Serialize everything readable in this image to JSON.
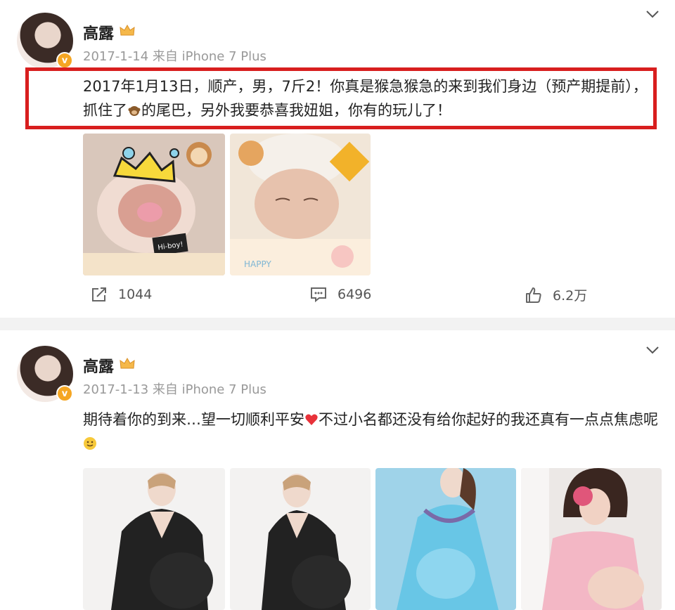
{
  "posts": [
    {
      "author": "高露",
      "meta": "2017-1-14 来自 iPhone 7 Plus",
      "text_parts": [
        "2017年1月13日，顺产，男，7斤2！你真是猴急猴急的来到我们身边（预产期提前），抓住了",
        "的尾巴，另外我要恭喜我妞姐，你有的玩儿了！"
      ],
      "images": [
        {
          "name": "baby-photo-1",
          "caption": "Hi-boy!"
        },
        {
          "name": "baby-photo-2",
          "caption": "HAPPY"
        }
      ],
      "actions": {
        "repost_count": "1044",
        "comment_count": "6496",
        "like_count": "6.2万"
      }
    },
    {
      "author": "高露",
      "meta": "2017-1-13 来自 iPhone 7 Plus",
      "text_parts": [
        "期待着你的到来…望一切顺利平安",
        "不过小名都还没有给你起好的我还真有一点点焦虑呢"
      ],
      "images": [
        {
          "name": "maternity-photo-1"
        },
        {
          "name": "maternity-photo-2"
        },
        {
          "name": "maternity-photo-3"
        },
        {
          "name": "maternity-photo-4"
        }
      ]
    }
  ],
  "icons": {
    "verified": "v-badge-icon",
    "crown": "crown-icon",
    "menu": "chevron-down-icon",
    "monkey": "monkey-emoji-icon",
    "heart": "heart-emoji-icon",
    "smile": "smile-emoji-icon",
    "repost": "repost-icon",
    "comment": "comment-icon",
    "like": "like-icon"
  },
  "colors": {
    "highlight_border": "#d81e1e",
    "verified_badge": "#f5a623",
    "meta_text": "#999999"
  }
}
